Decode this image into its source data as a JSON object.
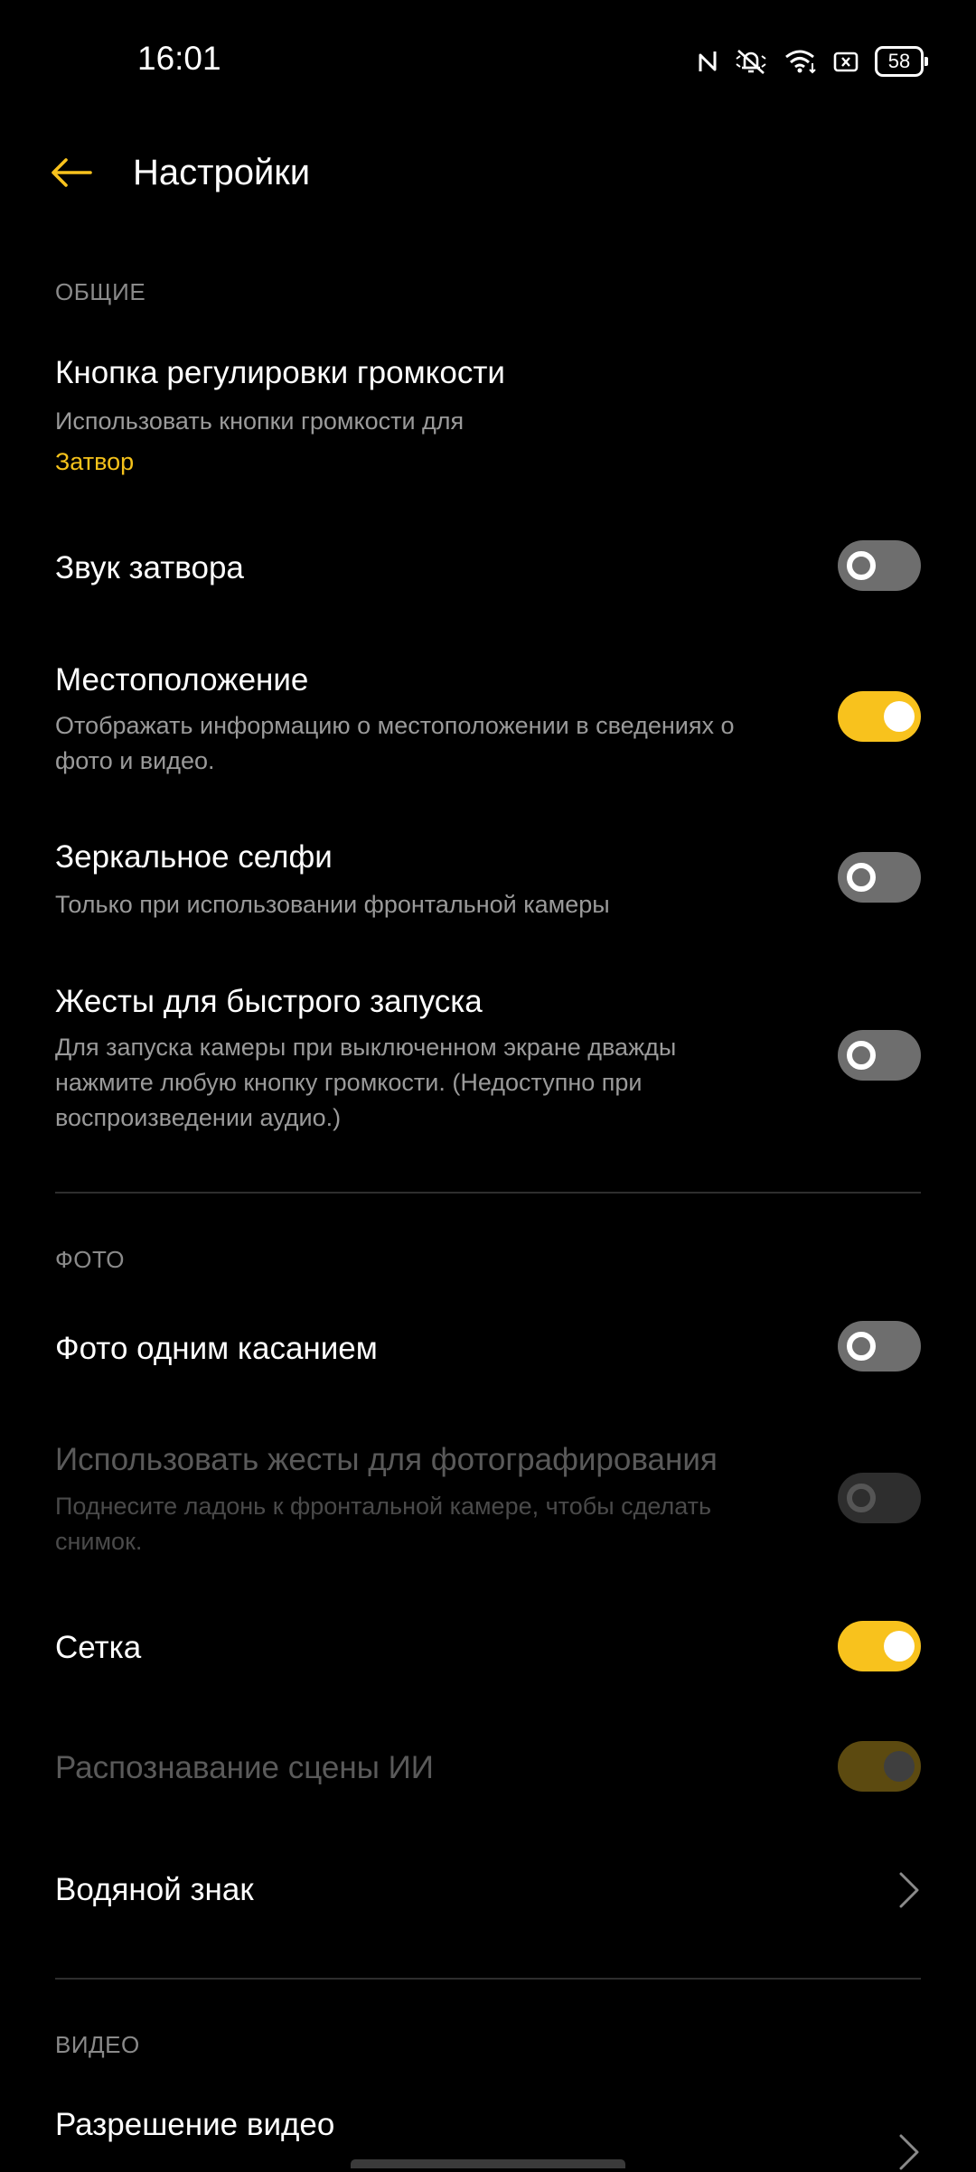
{
  "status_bar": {
    "time": "16:01",
    "battery_level": "58",
    "icons": [
      "nfc-icon",
      "silent-bell-icon",
      "wifi-icon",
      "sim-icon",
      "battery-icon"
    ]
  },
  "app_bar": {
    "title": "Настройки",
    "back_icon": "arrow-left-icon"
  },
  "colors": {
    "accent": "#f8c21d",
    "background": "#000000",
    "toggle_off": "#6e6e6e"
  },
  "sections": {
    "general": {
      "header": "ОБЩИЕ",
      "volume_key": {
        "title": "Кнопка регулировки громкости",
        "subtitle": "Использовать кнопки громкости для",
        "value": "Затвор"
      },
      "shutter_sound": {
        "title": "Звук затвора",
        "state": "off"
      },
      "location": {
        "title": "Местоположение",
        "subtitle": "Отображать информацию о местоположении в сведениях о фото и видео.",
        "state": "on"
      },
      "mirror_selfie": {
        "title": "Зеркальное селфи",
        "subtitle": "Только при использовании фронтальной камеры",
        "state": "off"
      },
      "quick_launch": {
        "title": "Жесты для быстрого запуска",
        "subtitle": "Для запуска камеры при выключенном экране дважды нажмите любую кнопку громкости. (Недоступно при воспроизведении аудио.)",
        "state": "off"
      }
    },
    "photo": {
      "header": "ФОТО",
      "one_touch": {
        "title": "Фото одним касанием",
        "state": "off"
      },
      "gesture_photo": {
        "title": "Использовать жесты для фотографирования",
        "subtitle": "Поднесите ладонь к фронтальной камере, чтобы сделать снимок.",
        "state": "off",
        "enabled": false
      },
      "grid": {
        "title": "Сетка",
        "state": "on"
      },
      "ai_scene": {
        "title": "Распознавание сцены ИИ",
        "state": "on",
        "enabled": false
      },
      "watermark": {
        "title": "Водяной знак"
      }
    },
    "video": {
      "header": "ВИДЕО",
      "resolution": {
        "title": "Разрешение видео"
      }
    }
  }
}
